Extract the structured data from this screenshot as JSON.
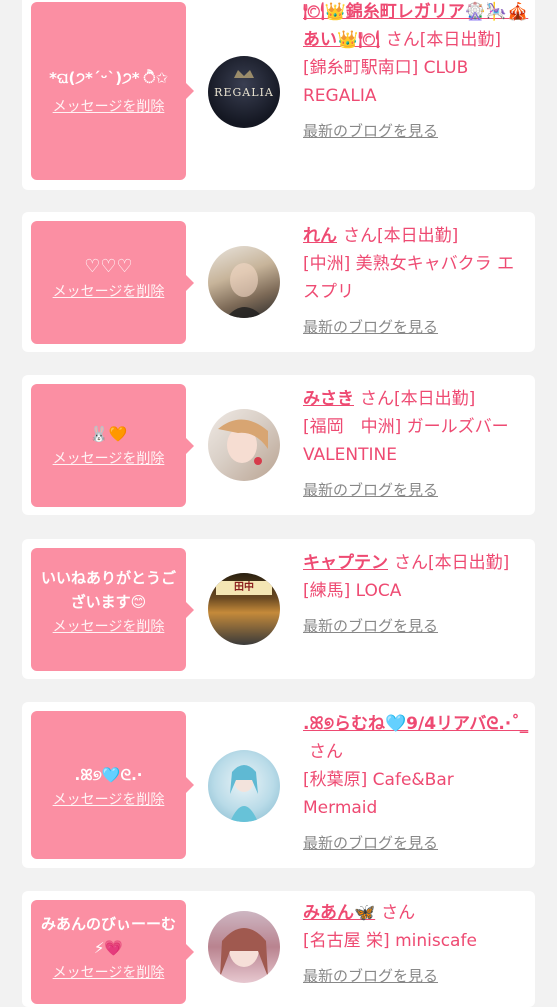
{
  "entries": [
    {
      "message": "*ଘ(੭*ˊᵕˋ)੭* ੈ✩",
      "delete_label": "メッセージを削除",
      "name": "🍽👑錦糸町レガリア🎡🎠🎪あい👑🍽",
      "san_status": "さん[本日出勤]",
      "shop": "[錦糸町駅南口] CLUB REGALIA",
      "blog_label": "最新のブログを見る",
      "avatar_text": "REGALIA"
    },
    {
      "message": "♡♡♡",
      "delete_label": "メッセージを削除",
      "name": "れん",
      "san_status": "さん[本日出勤]",
      "shop": "[中洲] 美熟女キャバクラ エスプリ",
      "blog_label": "最新のブログを見る"
    },
    {
      "message": "🐰🧡",
      "delete_label": "メッセージを削除",
      "name": "みさき",
      "san_status": "さん[本日出勤]",
      "shop": "[福岡　中洲] ガールズバー　VALENTINE",
      "blog_label": "最新のブログを見る"
    },
    {
      "message": "いいねありがとうございます😊",
      "delete_label": "メッセージを削除",
      "name": "キャプテン",
      "san_status": "さん[本日出勤]",
      "shop": "[練馬] LOCA",
      "blog_label": "最新のブログを見る",
      "avatar_text": "田中"
    },
    {
      "message": ".ꕤ୭🩵ᘓ.·",
      "delete_label": "メッセージを削除",
      "name": ".ꕤ୭らむね🩵9/4リアバᘓ.·˚_",
      "san_status": "さん",
      "shop": "[秋葉原] Cafe&Bar Mermaid",
      "blog_label": "最新のブログを見る"
    },
    {
      "message": "みあんのびぃーーむ⚡💗",
      "delete_label": "メッセージを削除",
      "name": "みあん🦋",
      "san_status": "さん",
      "shop": "[名古屋 栄] miniscafe",
      "blog_label": "最新のブログを見る"
    }
  ],
  "colors": {
    "accent": "#ee4a72",
    "bubble": "#fb8fa3",
    "background": "#f2f2f2"
  }
}
